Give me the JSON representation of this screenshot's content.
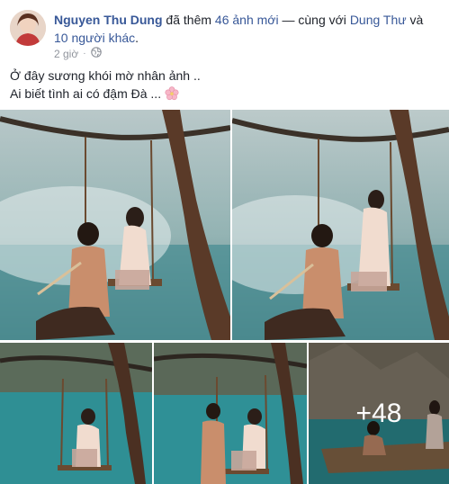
{
  "post": {
    "author_name": "Nguyen Thu Dung",
    "action_text": " đã thêm ",
    "photo_count_link": "46 ảnh mới",
    "with_text": " — cùng với ",
    "tagged_friend": "Dung Thư",
    "and_text": " và ",
    "others_link": "10 người khác",
    "end_punct": ".",
    "time": "2 giờ",
    "separator": "·",
    "privacy_icon": "globe-icon",
    "caption_line1": "Ở đây sương khói mờ nhân ảnh ..",
    "caption_line2": "Ai biết tình ai có đậm Đà ...",
    "caption_emoji": "cherry-blossom-icon",
    "more_photos_label": "+48"
  },
  "colors": {
    "link": "#385898",
    "meta": "#90949c",
    "text": "#1d2129"
  }
}
